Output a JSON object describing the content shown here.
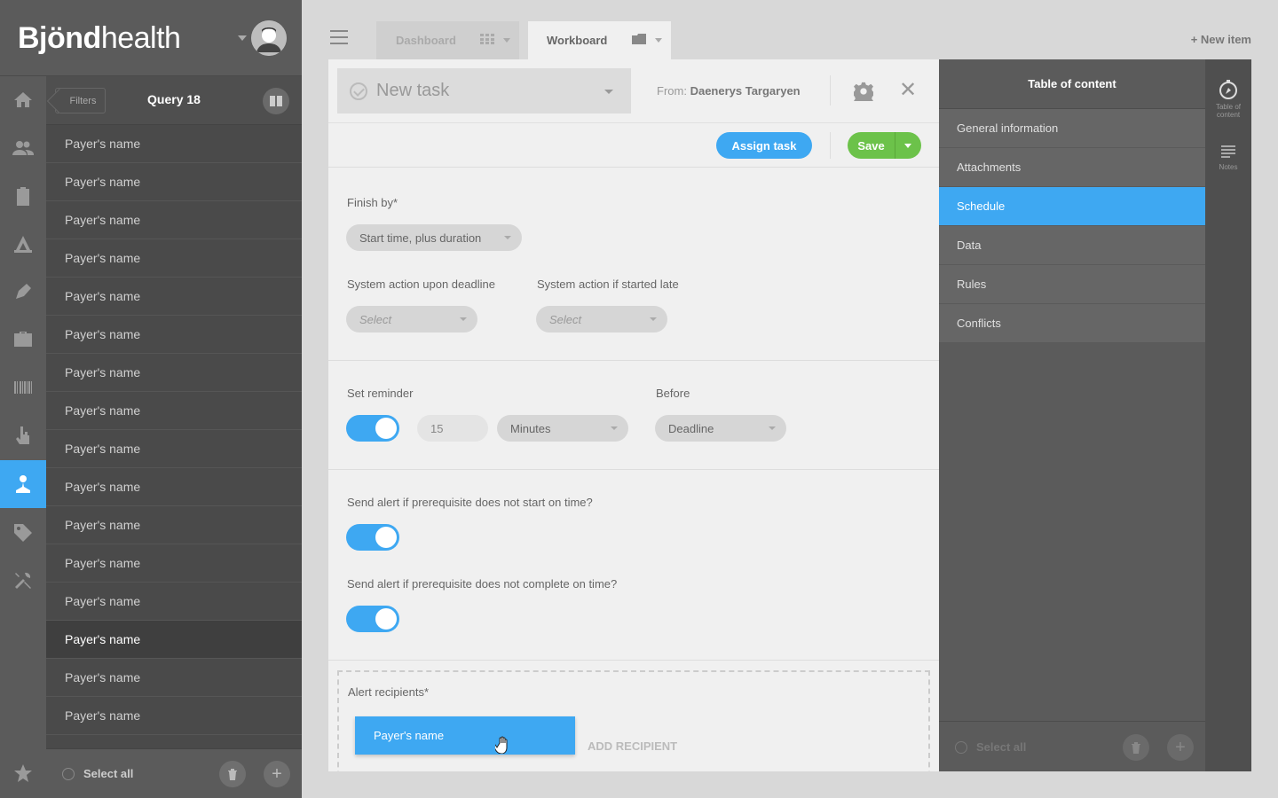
{
  "brand": {
    "bold": "Bjönd",
    "light": "health"
  },
  "rail": {
    "active_index": 9,
    "items": [
      "home-icon",
      "people-icon",
      "clipboard-icon",
      "stamp-icon",
      "pen-icon",
      "briefcase-icon",
      "barcode-icon",
      "hand-pointer-icon",
      "person-node-icon",
      "tag-icon",
      "tools-icon",
      "star-icon"
    ]
  },
  "list": {
    "filters_label": "Filters",
    "query_title": "Query 18",
    "items": [
      "Payer's name",
      "Payer's name",
      "Payer's name",
      "Payer's name",
      "Payer's name",
      "Payer's name",
      "Payer's name",
      "Payer's name",
      "Payer's name",
      "Payer's name",
      "Payer's name",
      "Payer's name",
      "Payer's name",
      "Payer's name",
      "Payer's name",
      "Payer's name"
    ],
    "selected_index": 13,
    "select_all": "Select all"
  },
  "tabs": [
    {
      "label": "Dashboard",
      "active": false
    },
    {
      "label": "Workboard",
      "active": true
    }
  ],
  "new_item": "+ New item",
  "task": {
    "name": "New task",
    "from_label": "From:",
    "from_name": "Daenerys Targaryen",
    "assign_label": "Assign task",
    "save_label": "Save"
  },
  "schedule": {
    "finish_by_label": "Finish by*",
    "finish_by_value": "Start time, plus duration",
    "deadline_action_label": "System action upon deadline",
    "deadline_action_value": "Select",
    "late_action_label": "System action if started late",
    "late_action_value": "Select",
    "reminder_label": "Set reminder",
    "reminder_on": true,
    "reminder_amount": "15",
    "reminder_unit": "Minutes",
    "before_label": "Before",
    "before_value": "Deadline",
    "alert_start_label": "Send alert if prerequisite does not start on time?",
    "alert_start_on": true,
    "alert_complete_label": "Send alert if prerequisite does not complete on time?",
    "alert_complete_on": true,
    "recipients_label": "Alert recipients*",
    "recipient_chip": "Payer's name",
    "add_recipient": "ADD RECIPIENT"
  },
  "toc": {
    "title": "Table of content",
    "items": [
      "General information",
      "Attachments",
      "Schedule",
      "Data",
      "Rules",
      "Conflicts"
    ],
    "active_index": 2,
    "select_all": "Select all"
  },
  "side_tools": [
    {
      "label": "Table of content",
      "icon": "compass-icon"
    },
    {
      "label": "Notes",
      "icon": "notes-icon"
    }
  ],
  "colors": {
    "accent": "#3ea8f2",
    "save": "#6cc24a",
    "sidebar": "#5b5b5b"
  }
}
